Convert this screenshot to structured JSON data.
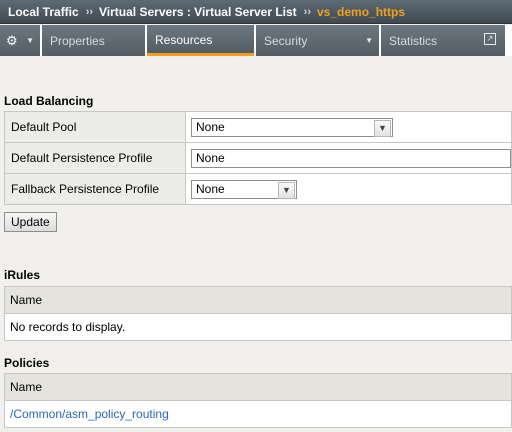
{
  "breadcrumb": {
    "items": [
      "Local Traffic",
      "Virtual Servers : Virtual Server List",
      "vs_demo_https"
    ],
    "separator": "››"
  },
  "tabs": {
    "gear_icon": "gear-icon",
    "items": [
      {
        "label": "Properties",
        "active": false
      },
      {
        "label": "Resources",
        "active": true
      },
      {
        "label": "Security",
        "active": false,
        "has_menu": true
      },
      {
        "label": "Statistics",
        "active": false,
        "external": true
      }
    ]
  },
  "load_balancing": {
    "title": "Load Balancing",
    "rows": [
      {
        "label": "Default Pool",
        "value": "None",
        "control": "select"
      },
      {
        "label": "Default Persistence Profile",
        "value": "None",
        "control": "text"
      },
      {
        "label": "Fallback Persistence Profile",
        "value": "None",
        "control": "select"
      }
    ],
    "update_button": "Update"
  },
  "irules": {
    "title": "iRules",
    "column": "Name",
    "empty_text": "No records to display."
  },
  "policies": {
    "title": "Policies",
    "column": "Name",
    "rows": [
      "/Common/asm_policy_routing"
    ]
  },
  "colors": {
    "accent": "#f2a11a",
    "link": "#2a66b6"
  }
}
